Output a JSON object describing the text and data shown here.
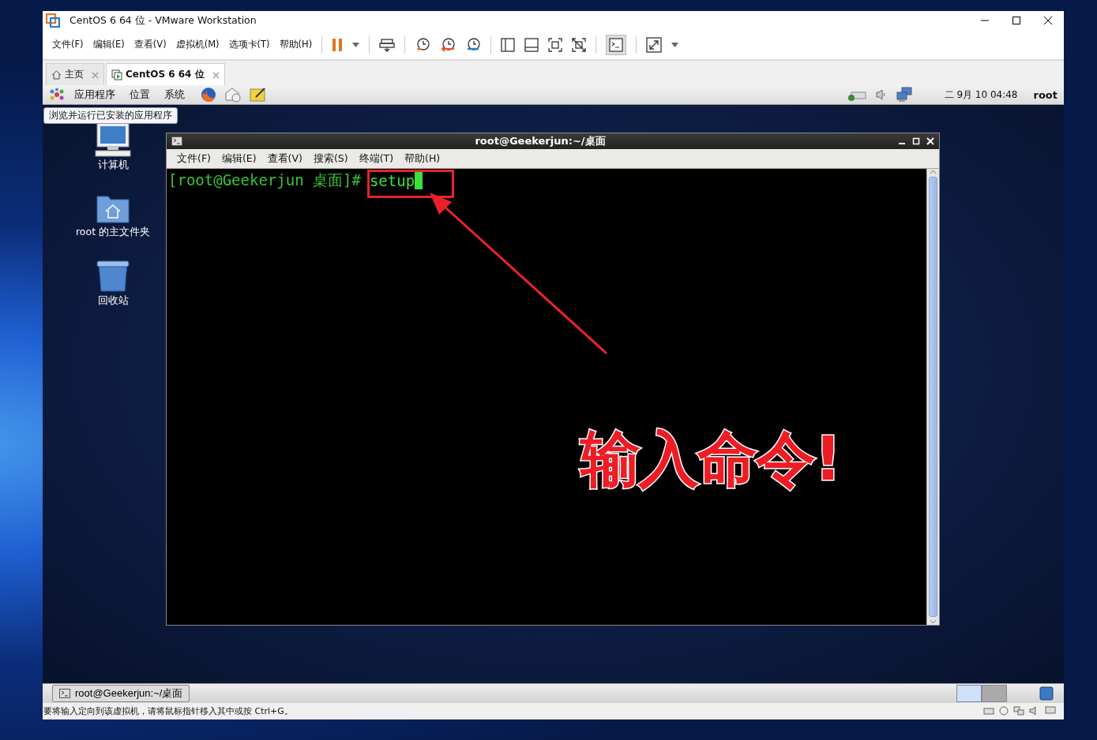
{
  "window": {
    "title": "CentOS 6 64 位 - VMware Workstation"
  },
  "menu": [
    "文件(F)",
    "编辑(E)",
    "查看(V)",
    "虚拟机(M)",
    "选项卡(T)",
    "帮助(H)"
  ],
  "tabs": [
    {
      "label": "主页",
      "selected": false
    },
    {
      "label": "CentOS 6 64 位",
      "selected": true
    }
  ],
  "guest_panel": {
    "menus": [
      "应用程序",
      "位置",
      "系统"
    ],
    "clock": "二 9月 10 04:48",
    "user": "root"
  },
  "tooltip": "浏览并运行已安装的应用程序",
  "desktop_icons": [
    {
      "kind": "computer",
      "label": "计算机"
    },
    {
      "kind": "home",
      "label": "root 的主文件夹"
    },
    {
      "kind": "trash",
      "label": "回收站"
    }
  ],
  "terminal": {
    "title": "root@Geekerjun:~/桌面",
    "menu": [
      "文件(F)",
      "编辑(E)",
      "查看(V)",
      "搜索(S)",
      "终端(T)",
      "帮助(H)"
    ],
    "prompt": "[root@Geekerjun 桌面]#",
    "command": "setup"
  },
  "annotation": {
    "text": "输入命令!"
  },
  "guest_taskbar": {
    "items": [
      "root@Geekerjun:~/桌面"
    ]
  },
  "status_bar": "要将输入定向到该虚拟机，请将鼠标指针移入其中或按 Ctrl+G。"
}
